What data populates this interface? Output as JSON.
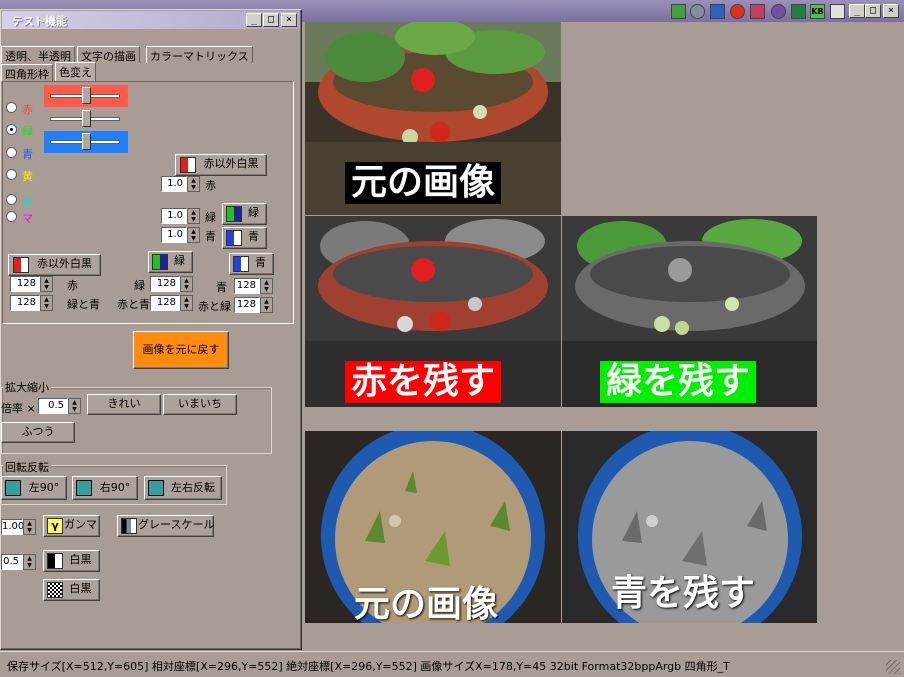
{
  "window": {
    "title": "テスト機能",
    "min_label": "_",
    "max_label": "□",
    "close_label": "×"
  },
  "top_window_controls": {
    "min_label": "_",
    "max_label": "□",
    "close_label": "×"
  },
  "tray_icons": [
    "check-icon",
    "gear-icon",
    "monitor-icon",
    "face-icon",
    "pen-icon",
    "swirl-icon",
    "excel-icon",
    "kb-icon",
    "printer-icon"
  ],
  "tray_kb_label": "KB",
  "tabs_row1": [
    "透明、半透明",
    "文字の描画",
    "カラーマトリックス"
  ],
  "tabs_row2": [
    "四角形枠",
    "色変え"
  ],
  "color_radios": [
    {
      "label": "赤",
      "color": "#ff4040",
      "checked": false
    },
    {
      "label": "緑",
      "color": "#20e020",
      "checked": true
    },
    {
      "label": "青",
      "color": "#2060ff",
      "checked": false
    },
    {
      "label": "黄",
      "color": "#f0f000",
      "checked": false
    },
    {
      "label": "水",
      "color": "#00e0e0",
      "checked": false
    },
    {
      "label": "マ",
      "color": "#ff00ff",
      "checked": false
    }
  ],
  "sliders": [
    {
      "color": "#ff5a4a",
      "level": 0.55
    },
    {
      "color": "#a89c94",
      "level": 0.55
    },
    {
      "color": "#2080ff",
      "level": 0.55
    }
  ],
  "mid": {
    "non_red_bw_label": "赤以外白黒",
    "factor_red": "1.0",
    "factor_red_label": "赤",
    "factor_green": "1.0",
    "factor_green_label": "緑",
    "factor_blue": "1.0",
    "factor_blue_label": "青",
    "green_btn_label": "緑",
    "blue_btn_label": "青"
  },
  "lower": {
    "non_red_bw_label": "赤以外白黒",
    "green_btn_label": "緑",
    "blue_btn_label": "青",
    "red_val": "128",
    "red_label": "赤",
    "gb_val": "128",
    "gb_label": "緑と青",
    "green_val": "128",
    "green_label": "緑",
    "rb_val": "128",
    "rb_label": "赤と青",
    "blue_val": "128",
    "blue_label": "青",
    "rg_val": "128",
    "rg_label": "赤と緑"
  },
  "restore_button": "画像を元に戻す",
  "scale": {
    "title": "拡大縮小",
    "factor_label": "倍率 ×",
    "factor_value": "0.5",
    "fine_button": "きれい",
    "rough_button": "いまいち",
    "normal_button": "ふつう"
  },
  "rotate": {
    "title": "回転反転",
    "left90": "左90°",
    "right90": "右90°",
    "flip": "左右反転"
  },
  "gamma": {
    "value": "1.00",
    "button": "ガンマ",
    "bw_value": "0.5",
    "bw_button": "白黒",
    "bw2_button": "白黒",
    "gray_button": "グレースケール"
  },
  "captions": {
    "tl": "元の画像",
    "ml": "赤を残す",
    "mr": "緑を残す",
    "bl": "元の画像",
    "br": "青を残す"
  },
  "caption_colors": {
    "tl_bg": "#000000",
    "ml_bg": "#ff0000",
    "mr_bg": "#00ee00"
  },
  "status": "保存サイズ[X=512,Y=605]  相対座標[X=296,Y=552]  絶対座標[X=296,Y=552]  画像サイズX=178,Y=45  32bit  Format32bppArgb  四角形_T"
}
